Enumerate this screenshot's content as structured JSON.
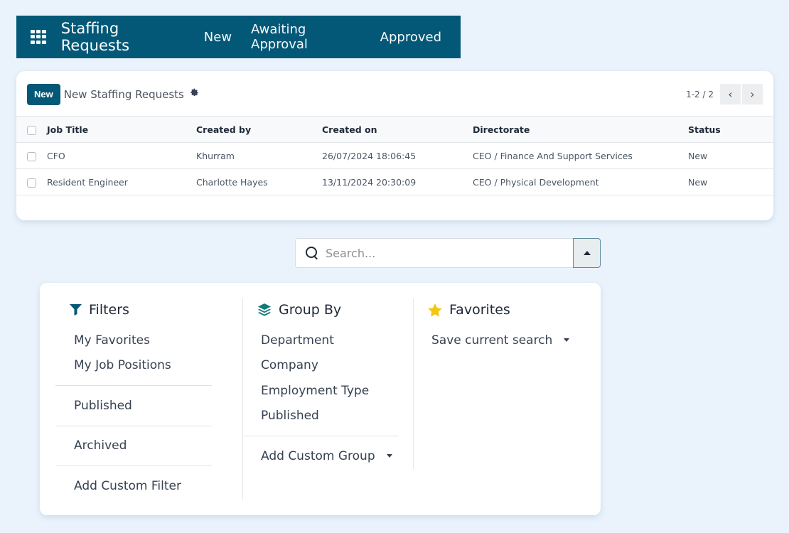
{
  "navbar": {
    "apps_icon": "apps-grid-icon",
    "title": "Staffing Requests",
    "items": [
      "New",
      "Awaiting Approval",
      "Approved"
    ]
  },
  "list": {
    "new_button": "New",
    "title": "New Staffing Requests",
    "gear_icon": "gear-icon",
    "pager": {
      "value": "1-2 / 2",
      "prev_icon": "chevron-left-icon",
      "next_icon": "chevron-right-icon",
      "prev_glyph": "‹",
      "next_glyph": "›"
    },
    "columns": [
      "Job Title",
      "Created by",
      "Created on",
      "Directorate",
      "Status"
    ],
    "rows": [
      [
        "CFO",
        "Khurram",
        "26/07/2024 18:06:45",
        "CEO / Finance And Support Services",
        "New"
      ],
      [
        "Resident Engineer",
        "Charlotte Hayes",
        "13/11/2024 20:30:09",
        "CEO / Physical Development",
        "New"
      ]
    ]
  },
  "search": {
    "placeholder": "Search...",
    "value": "",
    "icon": "search-icon",
    "toggle_icon": "caret-up-icon"
  },
  "panel": {
    "filters": {
      "title": "Filters",
      "icon": "filter-icon",
      "groups": [
        [
          "My Favorites",
          "My Job Positions"
        ],
        [
          "Published"
        ],
        [
          "Archived"
        ],
        [
          "Add Custom Filter"
        ]
      ]
    },
    "group_by": {
      "title": "Group By",
      "icon": "layers-icon",
      "items": [
        "Department",
        "Company",
        "Employment Type",
        "Published"
      ],
      "custom": "Add Custom Group"
    },
    "favorites": {
      "title": "Favorites",
      "icon": "star-icon",
      "save": "Save current search"
    }
  },
  "colors": {
    "brand": "#045877",
    "background": "#eaf3fc",
    "star": "#f3c613",
    "layers": "#0f7a7a"
  }
}
